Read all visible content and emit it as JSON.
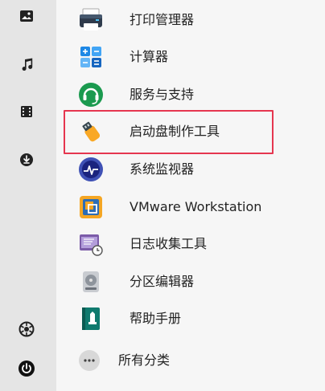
{
  "sidebar": {
    "items": [
      {
        "icon": "image-icon"
      },
      {
        "icon": "music-icon"
      },
      {
        "icon": "video-icon"
      },
      {
        "icon": "download-icon"
      },
      {
        "icon": "settings-icon"
      },
      {
        "icon": "power-icon"
      }
    ]
  },
  "apps": [
    {
      "label": "打印管理器",
      "icon": "printer-icon"
    },
    {
      "label": "计算器",
      "icon": "calculator-icon"
    },
    {
      "label": "服务与支持",
      "icon": "support-icon"
    },
    {
      "label": "启动盘制作工具",
      "icon": "boot-disk-icon"
    },
    {
      "label": "系统监视器",
      "icon": "system-monitor-icon"
    },
    {
      "label": "VMware Workstation",
      "icon": "vmware-icon"
    },
    {
      "label": "日志收集工具",
      "icon": "log-collector-icon"
    },
    {
      "label": "分区编辑器",
      "icon": "partition-editor-icon"
    },
    {
      "label": "帮助手册",
      "icon": "help-manual-icon"
    }
  ],
  "more": {
    "label": "所有分类",
    "icon": "more-icon"
  },
  "colors": {
    "highlight": "#e5364f",
    "sidebar_bg": "#e5e5e5",
    "main_bg": "#f6f6f6"
  }
}
